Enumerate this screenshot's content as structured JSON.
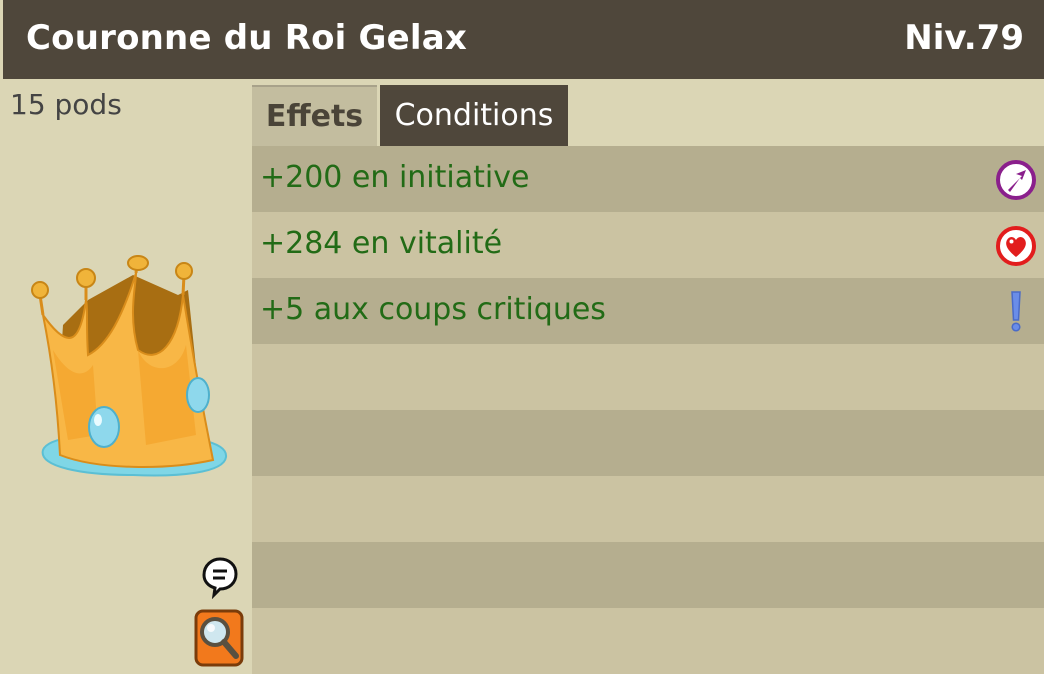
{
  "item": {
    "name": "Couronne du Roi Gelax",
    "level": "Niv.79",
    "weight": "15 pods"
  },
  "tabs": [
    {
      "label": "Effets",
      "active": true
    },
    {
      "label": "Conditions",
      "active": false
    }
  ],
  "effects": [
    {
      "text": "+200 en initiative",
      "icon": "initiative-arrow-icon"
    },
    {
      "text": "+284 en vitalité",
      "icon": "vitality-heart-icon"
    },
    {
      "text": "+5 aux coups critiques",
      "icon": "critical-exclamation-icon"
    }
  ],
  "empty_rows": 4,
  "colors": {
    "header_bg": "#4f473b",
    "panel_bg": "#dbd6b5",
    "row_dark": "#b5ae8f",
    "row_light": "#cbc3a2",
    "effect_text": "#226b16"
  }
}
